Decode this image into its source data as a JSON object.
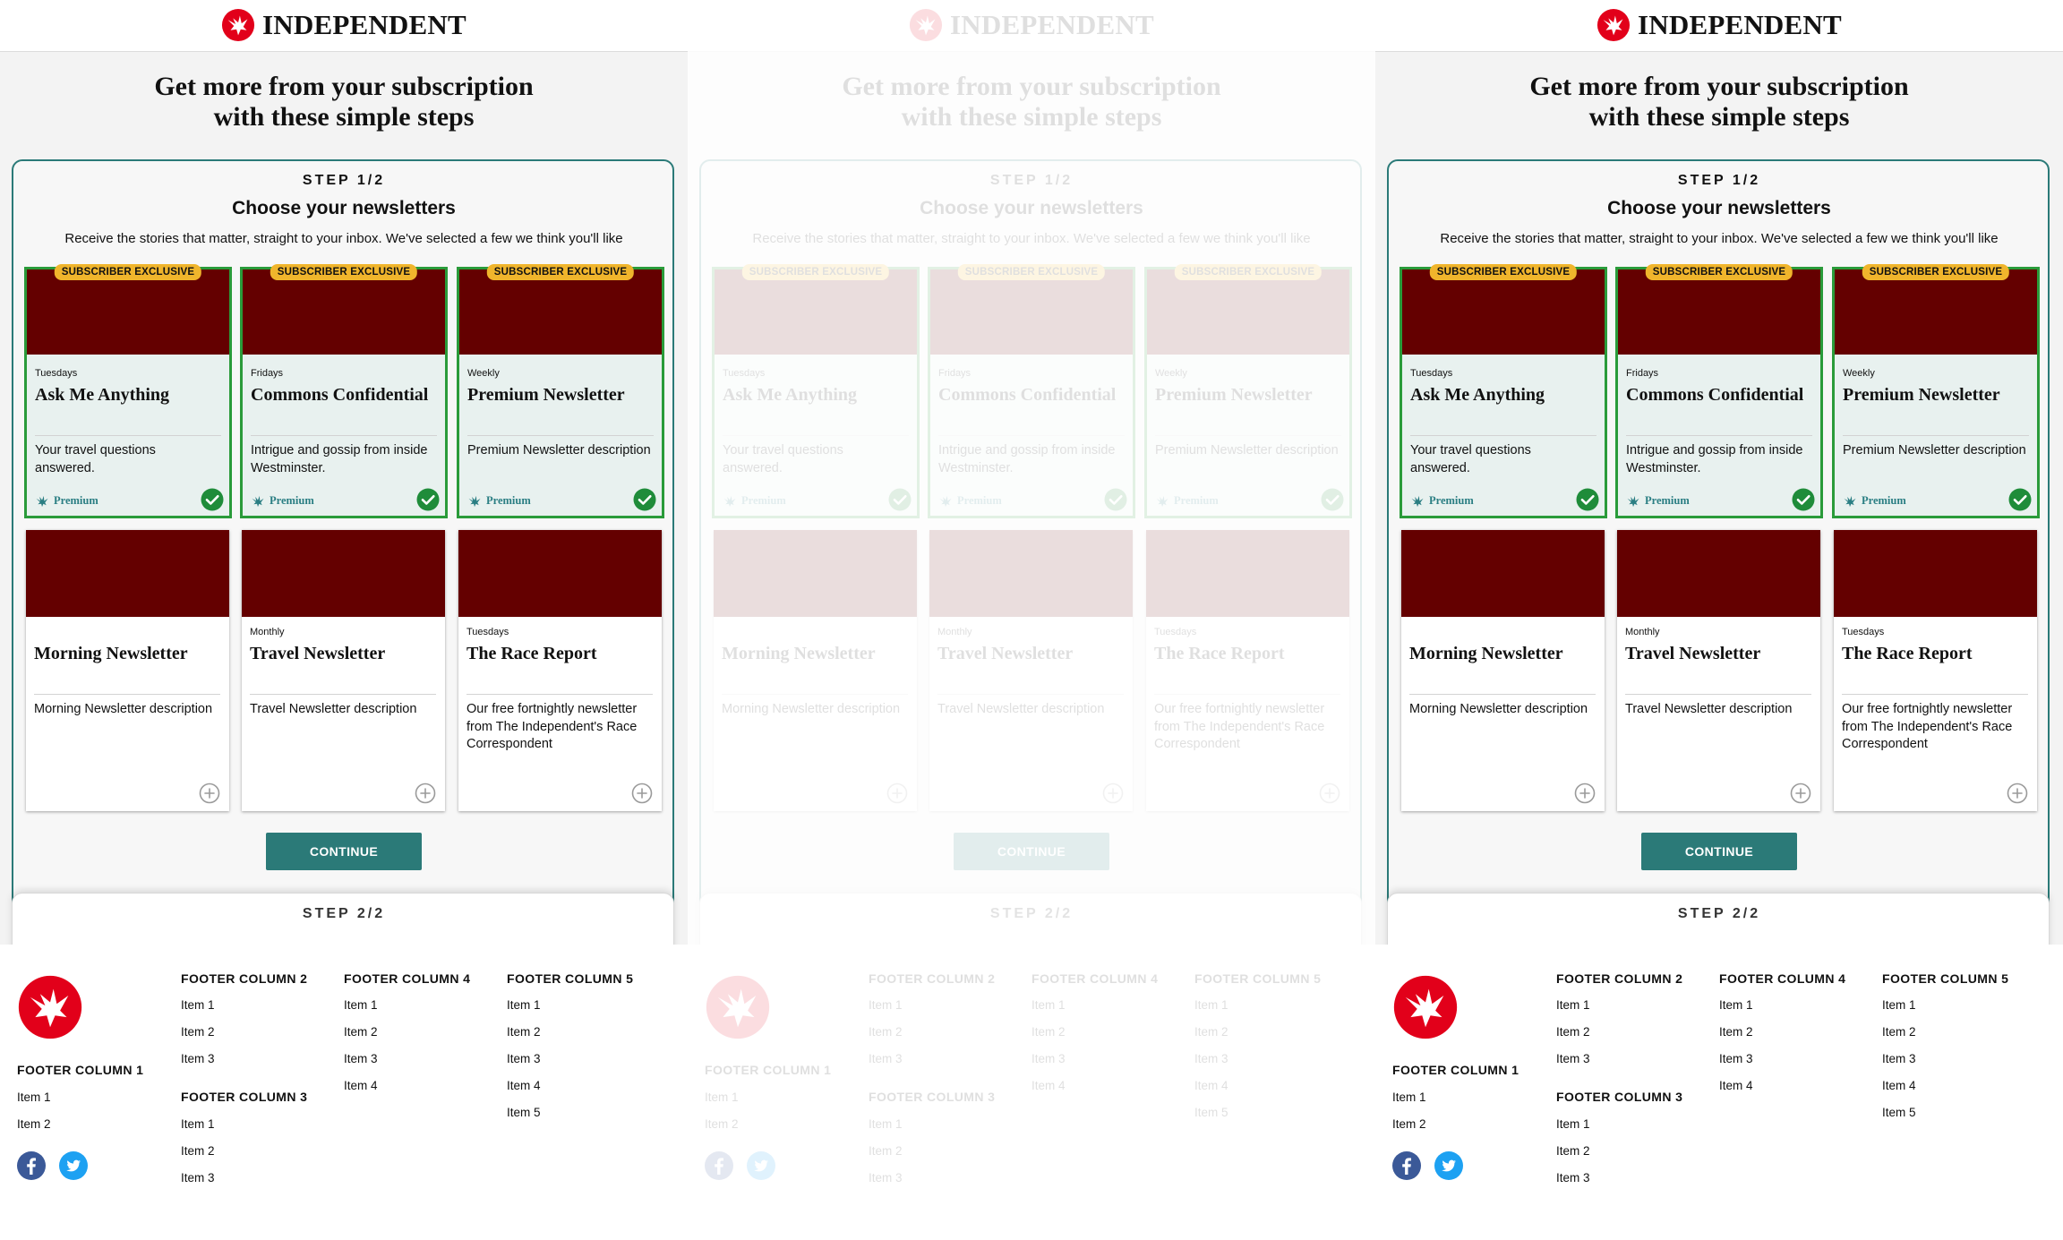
{
  "header": {
    "logo_text": "INDEPENDENT"
  },
  "hero": {
    "headline_line1": "Get more from your subscription",
    "headline_line2": "with these simple steps"
  },
  "step1": {
    "label": "STEP 1/2",
    "title": "Choose your newsletters",
    "description": "Receive the stories that matter, straight to your inbox. We've selected a few we think you'll like",
    "continue_label": "CONTINUE"
  },
  "badge_text": "SUBSCRIBER EXCLUSIVE",
  "premium_label": "Premium",
  "newsletters": [
    {
      "frequency": "Tuesdays",
      "title": "Ask Me Anything",
      "description": "Your travel questions answered.",
      "selected": true
    },
    {
      "frequency": "Fridays",
      "title": "Commons Confidential",
      "description": "Intrigue and gossip from inside Westminster.",
      "selected": true
    },
    {
      "frequency": "Weekly",
      "title": "Premium Newsletter",
      "description": "Premium Newsletter description",
      "selected": true
    },
    {
      "frequency": "",
      "title": "Morning Newsletter",
      "description": "Morning Newsletter description",
      "selected": false
    },
    {
      "frequency": "Monthly",
      "title": "Travel Newsletter",
      "description": "Travel Newsletter description",
      "selected": false
    },
    {
      "frequency": "Tuesdays",
      "title": "The Race Report",
      "description": "Our free fortnightly newsletter from The Independent's Race Correspondent",
      "selected": false
    }
  ],
  "step2": {
    "label": "STEP 2/2"
  },
  "footer": {
    "col1": {
      "heading": "FOOTER COLUMN 1",
      "items": [
        "Item 1",
        "Item 2"
      ]
    },
    "col2": {
      "heading": "FOOTER COLUMN 2",
      "items": [
        "Item 1",
        "Item 2",
        "Item 3"
      ]
    },
    "col3": {
      "heading": "FOOTER COLUMN 3",
      "items": [
        "Item 1",
        "Item 2",
        "Item 3"
      ]
    },
    "col4": {
      "heading": "FOOTER COLUMN 4",
      "items": [
        "Item 1",
        "Item 2",
        "Item 3",
        "Item 4"
      ]
    },
    "col5": {
      "heading": "FOOTER COLUMN 5",
      "items": [
        "Item 1",
        "Item 2",
        "Item 3",
        "Item 4",
        "Item 5"
      ]
    },
    "social": [
      "facebook-icon",
      "twitter-icon"
    ]
  },
  "colors": {
    "accent_teal": "#2b7a78",
    "selected_green": "#2a9b3a",
    "thumbnail_maroon": "#640000",
    "badge_yellow": "#f0b52c",
    "logo_red": "#e2001a",
    "facebook_blue": "#3b5998",
    "twitter_blue": "#1da1f2"
  },
  "panels": [
    "active",
    "faded",
    "active"
  ]
}
